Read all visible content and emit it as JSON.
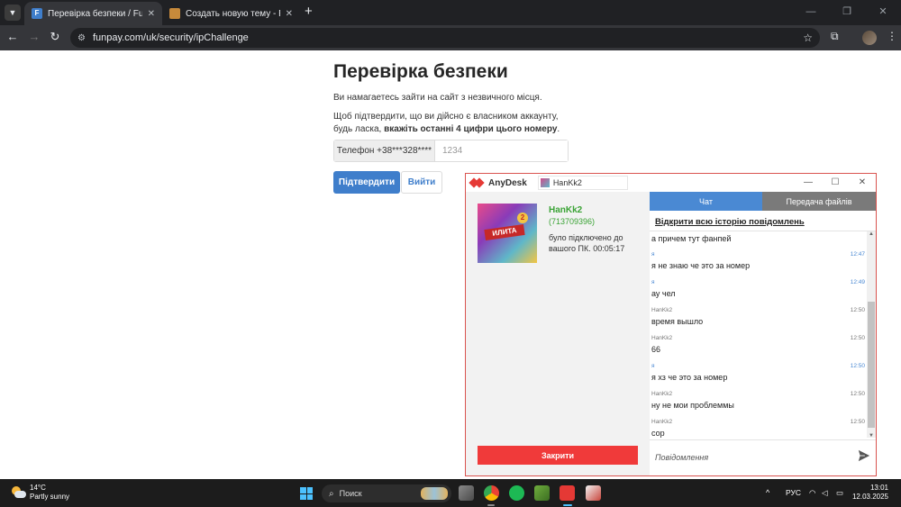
{
  "browser": {
    "tabs": [
      {
        "favicon": "F",
        "title": "Перевірка безпеки / FunPay",
        "active": true
      },
      {
        "favicon": "",
        "title": "Создать новую тему - ReallyW",
        "active": false
      }
    ],
    "url": "funpay.com/uk/security/ipChallenge"
  },
  "page": {
    "title": "Перевірка безпеки",
    "line1": "Ви намагаетесь зайти на сайт з незвичного місця.",
    "line2_start": "Щоб підтвердити, що ви дійсно є власником аккаунту, будь ласка, ",
    "line2_bold": "вкажіть останні 4 цифри цього номеру",
    "line2_end": ".",
    "phone_prefix": "Телефон +38***328****",
    "phone_placeholder": "1234",
    "confirm_label": "Підтвердити",
    "exit_label": "Вийти"
  },
  "anydesk": {
    "app_name": "AnyDesk",
    "tab_label": "HanKk2",
    "profile": {
      "image_text": "ИЛИТА",
      "badge": "2",
      "name": "HanKk2",
      "id": "(713709396)",
      "status": "було підключено до вашого ПК. 00:05:17"
    },
    "close_label": "Закрити",
    "tabs": {
      "chat": "Чат",
      "files": "Передача файлів"
    },
    "history_link": "Відкрити всю історію повідомлень",
    "messages": [
      {
        "sender": "",
        "time": "",
        "text": "а причем тут фанпей",
        "me": false
      },
      {
        "sender": "я",
        "time": "12:47",
        "text": "я не знаю че это за номер",
        "me": true
      },
      {
        "sender": "я",
        "time": "12:49",
        "text": "ау чел",
        "me": true
      },
      {
        "sender": "HanKk2",
        "time": "12:50",
        "text": "время вышло",
        "me": false
      },
      {
        "sender": "HanKk2",
        "time": "12:50",
        "text": "66",
        "me": false
      },
      {
        "sender": "я",
        "time": "12:50",
        "text": "я хз че это за номер",
        "me": true
      },
      {
        "sender": "HanKk2",
        "time": "12:50",
        "text": "ну не мои проблеммы",
        "me": false
      },
      {
        "sender": "HanKk2",
        "time": "12:50",
        "text": "сор",
        "me": false
      }
    ],
    "message_placeholder": "Повідомлення"
  },
  "taskbar": {
    "temp": "14°C",
    "weather": "Partly sunny",
    "search": "Поиск",
    "lang": "РУС",
    "time": "13:01",
    "date": "12.03.2025"
  },
  "colors": {
    "funpay_blue": "#3f7ecb",
    "anydesk_red": "#e53935",
    "close_red": "#f03a3a",
    "chat_tab_blue": "#4a89d3",
    "online_green": "#3aa335"
  }
}
